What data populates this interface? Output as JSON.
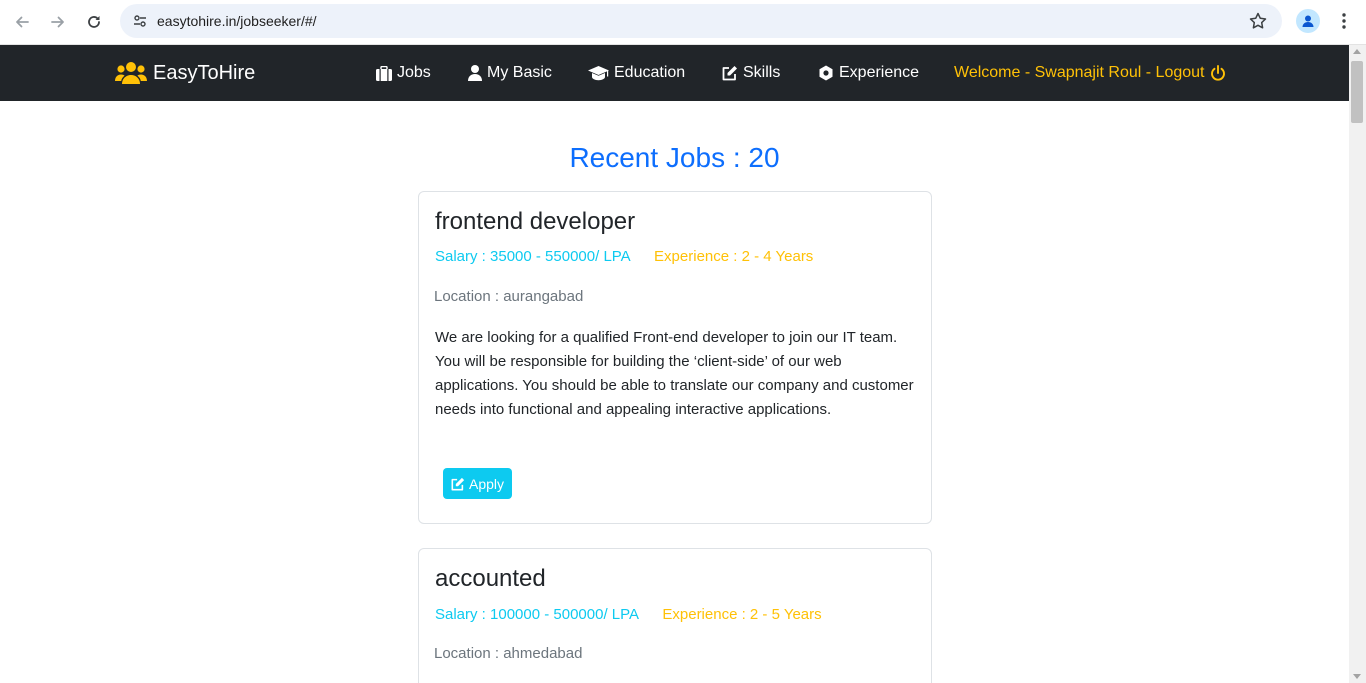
{
  "browser": {
    "url": "easytohire.in/jobseeker/#/"
  },
  "navbar": {
    "brand": "EasyToHire",
    "items": [
      {
        "label": "Jobs",
        "icon": "briefcase-icon"
      },
      {
        "label": "My Basic",
        "icon": "user-icon"
      },
      {
        "label": "Education",
        "icon": "graduation-cap-icon"
      },
      {
        "label": "Skills",
        "icon": "edit-icon"
      },
      {
        "label": "Experience",
        "icon": "cog-icon"
      }
    ],
    "welcome": "Welcome - Swapnajit Roul - Logout"
  },
  "main": {
    "heading": "Recent Jobs : 20",
    "jobs": [
      {
        "title": "frontend developer",
        "salary": "Salary : 35000 - 550000/ LPA",
        "experience": "Experience : 2 - 4 Years",
        "location": "Location : aurangabad",
        "description": "We are looking for a qualified Front-end developer to join our IT team. You will be responsible for building the ‘client-side’ of our web applications. You should be able to translate our company and customer needs into functional and appealing interactive applications.",
        "apply_label": "Apply"
      },
      {
        "title": "accounted",
        "salary": "Salary : 100000 - 500000/ LPA",
        "experience": "Experience : 2 - 5 Years",
        "location": "Location : ahmedabad"
      }
    ]
  },
  "colors": {
    "navbar_bg": "#212529",
    "heading": "#0d6efd",
    "salary": "#0dcaf0",
    "experience": "#ffc107",
    "apply_button": "#0dcaf0"
  }
}
